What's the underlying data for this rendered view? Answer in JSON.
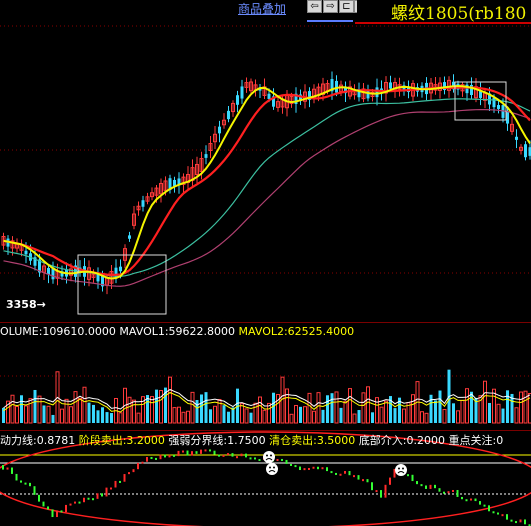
{
  "toolbar": {
    "overlay_label": "商品叠加",
    "nav_buttons": [
      "⇦",
      "⇨",
      "⊏",
      "⊐"
    ],
    "symbol_title": "螺纹1805(rb180"
  },
  "price_panel": {
    "low_label": "3358"
  },
  "volume_panel": {
    "volume_name": "OLUME:109610.0000",
    "mavol1_name": "MAVOL1:59622.8000",
    "mavol2_name": "MAVOL2:62525.4000",
    "colors": {
      "volume": "#ffffff",
      "mavol1": "#ffffff",
      "mavol2": "#ffff00"
    }
  },
  "indicator_panel": {
    "items": [
      {
        "text": "动力线:0.8781",
        "color": "#ffffff"
      },
      {
        "text": "阶段卖出:3.2000",
        "color": "#ffff00"
      },
      {
        "text": "强弱分界线:1.7500",
        "color": "#ffffff"
      },
      {
        "text": "清仓卖出:3.5000",
        "color": "#ffff00"
      },
      {
        "text": "底部介入:0.2000",
        "color": "#ffffff"
      },
      {
        "text": "重点关注:0",
        "color": "#ffffff"
      }
    ]
  },
  "colors": {
    "up": "#ff3b3b",
    "down": "#39d9ff",
    "ma_yellow": "#f5f500",
    "ma_red": "#ff2020",
    "ma_teal": "#3cbfa0",
    "ma_purple": "#b04070",
    "ind_green": "#33ff33",
    "ind_red": "#ff2a2a"
  }
}
